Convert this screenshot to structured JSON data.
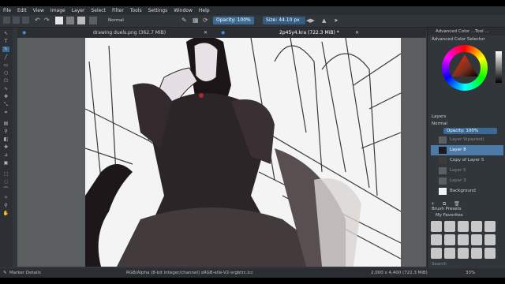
{
  "menubar": {
    "items": [
      "File",
      "Edit",
      "View",
      "Image",
      "Layer",
      "Select",
      "Filter",
      "Tools",
      "Settings",
      "Window",
      "Help"
    ]
  },
  "toolbar": {
    "blend_mode": "Normal",
    "opacity": "Opacity: 100%",
    "size": "Size: 44.10 px"
  },
  "tabs": [
    {
      "label": "drawing duels.png (362.7 MiB)"
    },
    {
      "label": "2p45y4.kra (722.3 MiB) *"
    }
  ],
  "statusbar": {
    "left": "Marker Details",
    "color_info": "RGB/Alpha (8-bit integer/channel)  sRGB-elle-V2-srgbtrc.icc",
    "dimensions": "2,000 x 4,400 (722.3 MiB)",
    "zoom": "33%"
  },
  "dock": {
    "tabs": [
      "Advanced Color ...",
      "Tool ..."
    ],
    "color_selector_title": "Advanced Color Selector",
    "layers_title": "Layers",
    "blend_mode": "Normal",
    "opacity": "Opacity: 100%",
    "layers": [
      {
        "name": "Layer 9(pasted)",
        "active": false
      },
      {
        "name": "Layer 8",
        "active": true
      },
      {
        "name": "Copy of Layer 5",
        "active": false
      },
      {
        "name": "Layer 5",
        "active": false
      },
      {
        "name": "Layer 3",
        "active": false
      },
      {
        "name": "Background",
        "active": false
      }
    ],
    "brush_presets_title": "Brush Presets",
    "brush_favorites": "My Favorites",
    "brush_search": "Search"
  },
  "colors": {
    "accent": "#3b6b95",
    "active_layer": "#4e7aa8"
  }
}
